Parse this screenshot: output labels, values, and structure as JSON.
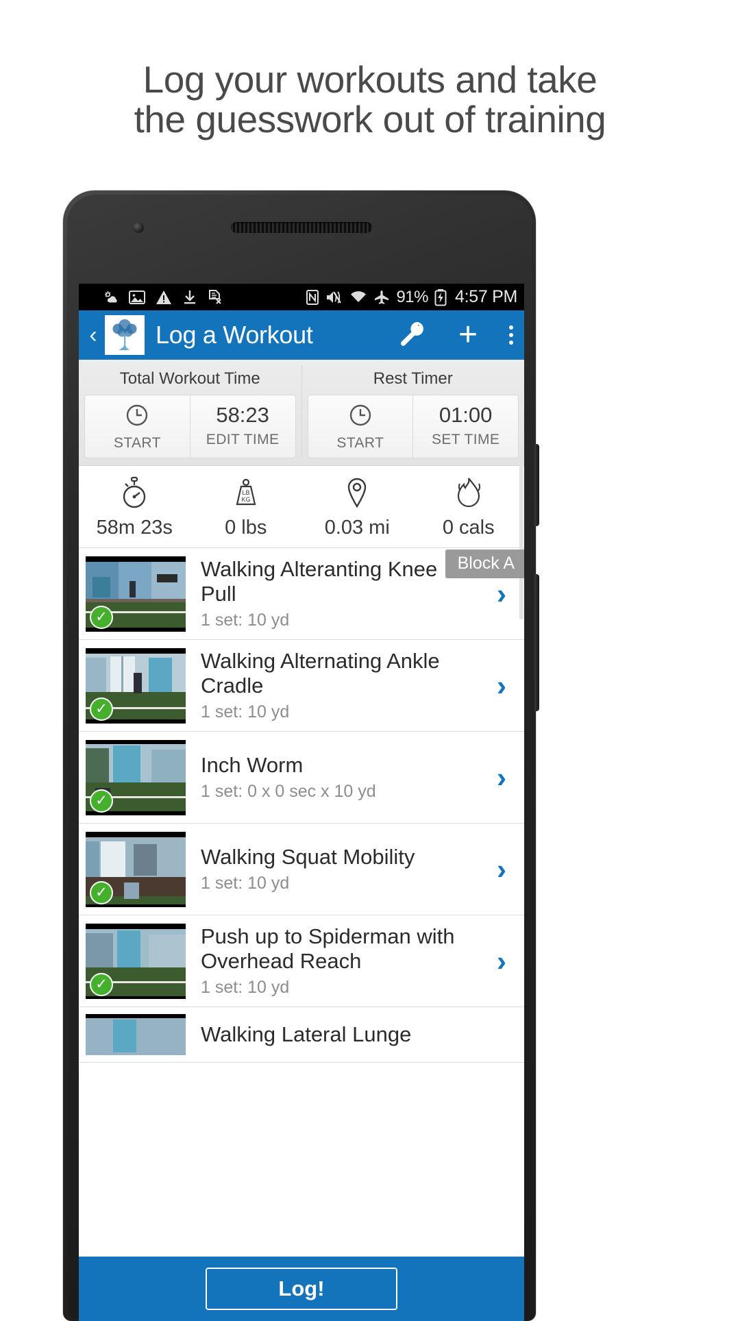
{
  "headline": {
    "line1": "Log your workouts and take",
    "line2": "the guesswork out of training"
  },
  "statusbar": {
    "icons_left": [
      "weather-partly-cloudy-icon",
      "image-icon",
      "warning-triangle-icon",
      "download-icon",
      "file-error-icon"
    ],
    "icons_right": [
      "nfc-icon",
      "mute-vibrate-icon",
      "wifi-icon",
      "airplane-mode-icon"
    ],
    "battery": "91%",
    "battery_icon": "battery-charging-icon",
    "time": "4:57 PM"
  },
  "actionbar": {
    "back_icon": "back-chevron-icon",
    "logo_icon": "tree-logo-icon",
    "title": "Log a Workout",
    "wrench_icon": "wrench-icon",
    "plus_icon": "plus-icon",
    "overflow_icon": "overflow-menu-icon",
    "color": "#1474bb"
  },
  "timers": [
    {
      "label": "Total Workout Time",
      "start_icon": "clock-icon",
      "start_label": "START",
      "value": "58:23",
      "value_label": "EDIT TIME"
    },
    {
      "label": "Rest Timer",
      "start_icon": "clock-icon",
      "start_label": "START",
      "value": "01:00",
      "value_label": "SET TIME"
    }
  ],
  "stats": [
    {
      "icon": "stopwatch-icon",
      "value": "58m 23s"
    },
    {
      "icon": "weight-icon",
      "value": "0 lbs"
    },
    {
      "icon": "location-pin-icon",
      "value": "0.03 mi"
    },
    {
      "icon": "flame-icon",
      "value": "0 cals"
    }
  ],
  "block_badge": "Block A",
  "exercises": [
    {
      "title": "Walking Alteranting Knee Pull",
      "detail": "1 set: 10 yd",
      "completed": true,
      "chevron": "chevron-right-icon"
    },
    {
      "title": "Walking Alternating Ankle Cradle",
      "detail": "1 set: 10 yd",
      "completed": true,
      "chevron": "chevron-right-icon"
    },
    {
      "title": "Inch Worm",
      "detail": "1 set: 0 x 0 sec x 10 yd",
      "completed": true,
      "chevron": "chevron-right-icon"
    },
    {
      "title": "Walking Squat Mobility",
      "detail": "1 set: 10 yd",
      "completed": true,
      "chevron": "chevron-right-icon"
    },
    {
      "title": "Push up to Spiderman with Overhead Reach",
      "detail": "1 set: 10 yd",
      "completed": true,
      "chevron": "chevron-right-icon"
    },
    {
      "title": "Walking Lateral Lunge",
      "detail": "",
      "completed": false,
      "chevron": "chevron-right-icon"
    }
  ],
  "bottombar": {
    "log_label": "Log!"
  }
}
